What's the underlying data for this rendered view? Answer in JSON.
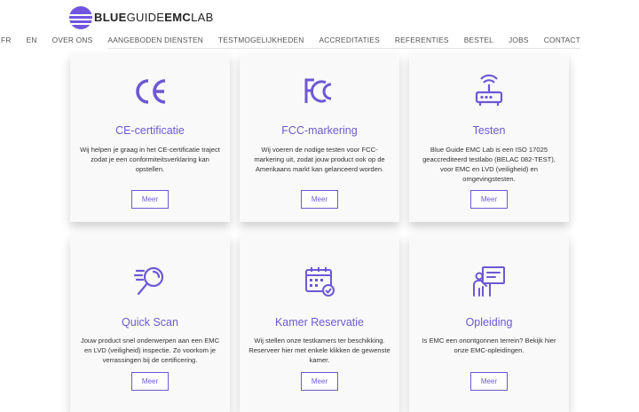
{
  "brand": {
    "part1": "BLUE",
    "part2": "GUIDE",
    "part3": "EMC",
    "part4": "LAB"
  },
  "nav": [
    "FR",
    "EN",
    "OVER ONS",
    "AANGEBODEN DIENSTEN",
    "TESTMOGELIJKHEDEN",
    "ACCREDITATIES",
    "REFERENTIES",
    "BESTEL",
    "JOBS",
    "CONTACT"
  ],
  "colors": {
    "accent": "#6e58d4",
    "card_bg": "#f9f9f9"
  },
  "cards": [
    {
      "icon": "ce-mark-icon",
      "title": "CE-certificatie",
      "desc": "Wij helpen je graag in het CE-certificatie traject zodat je een conformiteitsverklaring kan opstellen.",
      "button": "Meer"
    },
    {
      "icon": "fcc-mark-icon",
      "title": "FCC-markering",
      "desc": "Wij voeren de nodige testen voor FCC-markering uit, zodat jouw product ook op de Amerikaans markt kan gelanceerd worden.",
      "button": "Meer"
    },
    {
      "icon": "router-icon",
      "title": "Testen",
      "desc": "Blue Guide EMC Lab is een ISO 17025 geaccrediteerd testlabo (BELAC 082-TEST), voor EMC en LVD (veiligheid) en omgevingstesten.",
      "button": "Meer"
    },
    {
      "icon": "magnifier-icon",
      "title": "Quick Scan",
      "desc": "Jouw product snel onderwerpen aan een EMC en LVD (veiligheid) inspectie. Zo voorkom je verrassingen bij de certificering.",
      "button": "Meer"
    },
    {
      "icon": "calendar-icon",
      "title": "Kamer Reservatie",
      "desc": "Wij stellen onze testkamers ter beschikking. Reserveer hier met enkele klikken de gewenste kamer.",
      "button": "Meer"
    },
    {
      "icon": "presentation-icon",
      "title": "Opleiding",
      "desc": "Is EMC een onontgonnen terrein? Bekijk hier onze EMC-opleidingen.",
      "button": "Meer"
    }
  ]
}
